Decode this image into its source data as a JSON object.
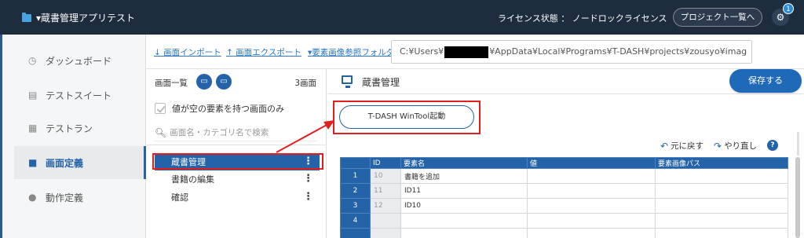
{
  "header": {
    "project_name": "▾蔵書管理アプリテスト",
    "license_label": "ライセンス状態 ： ノードロックライセンス",
    "project_list_button": "プロジェクト一覧へ",
    "notification_count": "1"
  },
  "sidebar": {
    "items": [
      {
        "label": "ダッシュボード",
        "icon": "clock-icon"
      },
      {
        "label": "テストスイート",
        "icon": "suite-icon"
      },
      {
        "label": "テストラン",
        "icon": "document-icon"
      },
      {
        "label": "画面定義",
        "icon": "monitor-icon",
        "active": true
      },
      {
        "label": "動作定義",
        "icon": "check-circle-icon"
      }
    ]
  },
  "toolbar": {
    "import_label": "画面インポート",
    "export_label": "画面エクスポート",
    "folder_label": "要素画像参照フォルダ",
    "path_prefix": "C:¥Users¥",
    "path_suffix": "¥AppData¥Local¥Programs¥T-DASH¥projects¥zousyo¥imag"
  },
  "screen_list": {
    "title": "画面一覧",
    "count": "3画面",
    "filter_label": "値が空の要素を持つ画面のみ",
    "search_placeholder": "画面名・カテゴリ名で検索",
    "items": [
      "蔵書管理",
      "書籍の編集",
      "確認"
    ]
  },
  "editor": {
    "title": "蔵書管理",
    "save_button": "保存する",
    "wintool_button": "T-DASH WinTool起動",
    "undo_label": "元に戻す",
    "redo_label": "やり直し",
    "help": "?",
    "columns": [
      "ID",
      "要素名",
      "値",
      "要素画像パス"
    ],
    "rows": [
      {
        "num": "1",
        "id": "10",
        "name": "書籍を追加",
        "value": "",
        "path": ""
      },
      {
        "num": "2",
        "id": "11",
        "name": "ID11",
        "value": "",
        "path": ""
      },
      {
        "num": "3",
        "id": "12",
        "name": "ID10",
        "value": "",
        "path": ""
      },
      {
        "num": "4",
        "id": "",
        "name": "",
        "value": "",
        "path": ""
      },
      {
        "num": "",
        "id": "",
        "name": "",
        "value": "",
        "path": ""
      }
    ]
  },
  "colors": {
    "header_bg": "#1e2d3d",
    "accent": "#2563a8",
    "highlight": "#e02020"
  }
}
